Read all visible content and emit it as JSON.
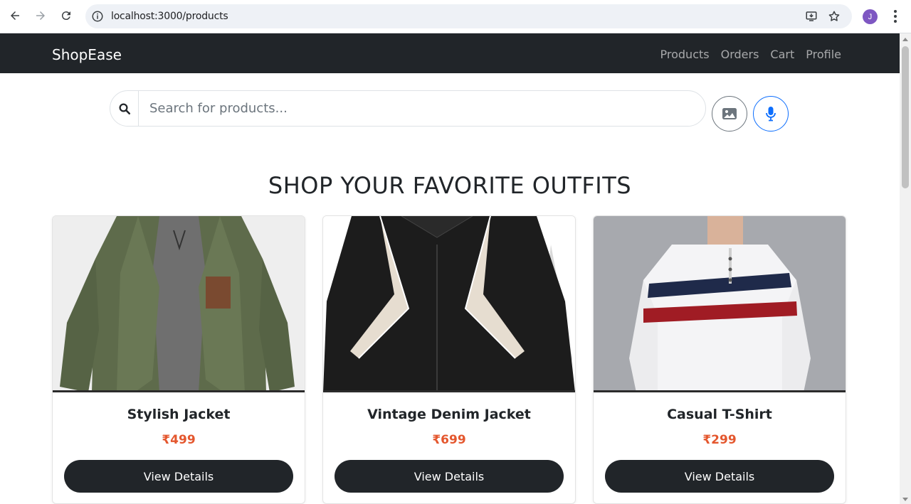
{
  "browser": {
    "url": "localhost:3000/products",
    "profile_initial": "J"
  },
  "navbar": {
    "brand": "ShopEase",
    "links": [
      "Products",
      "Orders",
      "Cart",
      "Profile"
    ]
  },
  "search": {
    "placeholder": "Search for products..."
  },
  "heading": "SHOP YOUR FAVORITE OUTFITS",
  "products": [
    {
      "name": "Stylish Jacket",
      "price": "₹499",
      "button": "View Details"
    },
    {
      "name": "Vintage Denim Jacket",
      "price": "₹699",
      "button": "View Details"
    },
    {
      "name": "Casual T-Shirt",
      "price": "₹299",
      "button": "View Details"
    }
  ],
  "colors": {
    "navbar_bg": "#212529",
    "price": "#e4572e",
    "button_bg": "#212529",
    "mic_accent": "#0d6efd"
  }
}
